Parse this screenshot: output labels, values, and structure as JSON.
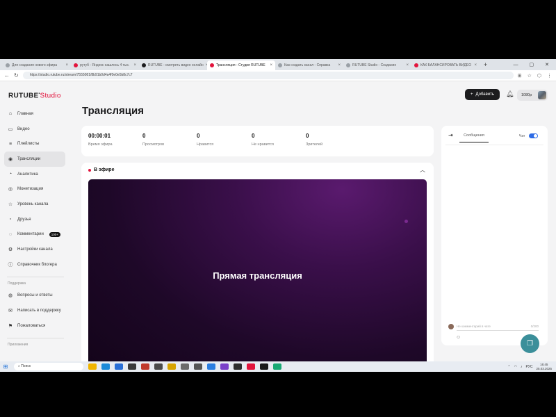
{
  "browser": {
    "tabs": [
      {
        "title": "Для создания нового эфира",
        "color": "#9aa0a6"
      },
      {
        "title": "рутуб - Яндекс нашлось 4 тыс.",
        "color": "#e2143c"
      },
      {
        "title": "RUTUBE - смотреть видео онлайн",
        "color": "#1c1c1e"
      },
      {
        "title": "Трансляция - Студия RUTUBE",
        "color": "#e2143c"
      },
      {
        "title": "Как создать канал - Справка",
        "color": "#9aa0a6"
      },
      {
        "title": "RUTUBE Studio - Создание",
        "color": "#9aa0a6"
      },
      {
        "title": "КАК БАЛАНСИРОВАТЬ ВИДЕО",
        "color": "#e2143c"
      }
    ],
    "new_tab": "+",
    "url": "https://studio.rutube.ru/stream/7555081/8b91b0d4a4f0e0e5b8c7c7"
  },
  "header": {
    "logo_main": "RUTUBE",
    "logo_studio": "Studio",
    "add_button": "Добавить",
    "resolution": "1080p"
  },
  "sidebar": {
    "items": [
      {
        "label": "Главная",
        "icon": "home-icon",
        "glyph": "⌂"
      },
      {
        "label": "Видео",
        "icon": "video-icon",
        "glyph": "▭"
      },
      {
        "label": "Плейлисты",
        "icon": "playlist-icon",
        "glyph": "≡"
      },
      {
        "label": "Трансляции",
        "icon": "broadcast-icon",
        "glyph": "◉",
        "active": true
      },
      {
        "label": "Аналитика",
        "icon": "analytics-icon",
        "glyph": "◔"
      },
      {
        "label": "Монетизация",
        "icon": "money-icon",
        "glyph": "◎"
      },
      {
        "label": "Уровень канала",
        "icon": "star-icon",
        "glyph": "☆"
      },
      {
        "label": "Друзья",
        "icon": "friends-icon",
        "glyph": "▫"
      },
      {
        "label": "Комментарии",
        "icon": "comments-icon",
        "glyph": "◌",
        "badge": "100+"
      },
      {
        "label": "Настройки канала",
        "icon": "gear-icon",
        "glyph": "⚙"
      },
      {
        "label": "Справочник блогера",
        "icon": "info-icon",
        "glyph": "ⓘ"
      }
    ],
    "support_section": "Поддержка",
    "support_items": [
      {
        "label": "Вопросы и ответы",
        "icon": "question-icon",
        "glyph": "◍"
      },
      {
        "label": "Написать в поддержку",
        "icon": "mail-icon",
        "glyph": "✉"
      },
      {
        "label": "Пожаловаться",
        "icon": "flag-icon",
        "glyph": "⚑"
      }
    ],
    "app_section": "Приложения"
  },
  "main": {
    "title": "Трансляция",
    "stats": [
      {
        "value": "00:00:01",
        "label": "Время эфира"
      },
      {
        "value": "0",
        "label": "Просмотров"
      },
      {
        "value": "0",
        "label": "Нравится"
      },
      {
        "value": "0",
        "label": "Не нравится"
      },
      {
        "value": "0",
        "label": "Зрителей"
      }
    ],
    "live_label": "В эфире",
    "video_text": "Прямая трансляция"
  },
  "chat": {
    "tab": "Сообщения",
    "toggle_label": "Чат",
    "input_placeholder": "Не комментарий в чате",
    "counter": "0/200"
  },
  "taskbar": {
    "search": "Поиск",
    "lang": "РУС",
    "time": "16:45",
    "date": "25.03.2025"
  }
}
